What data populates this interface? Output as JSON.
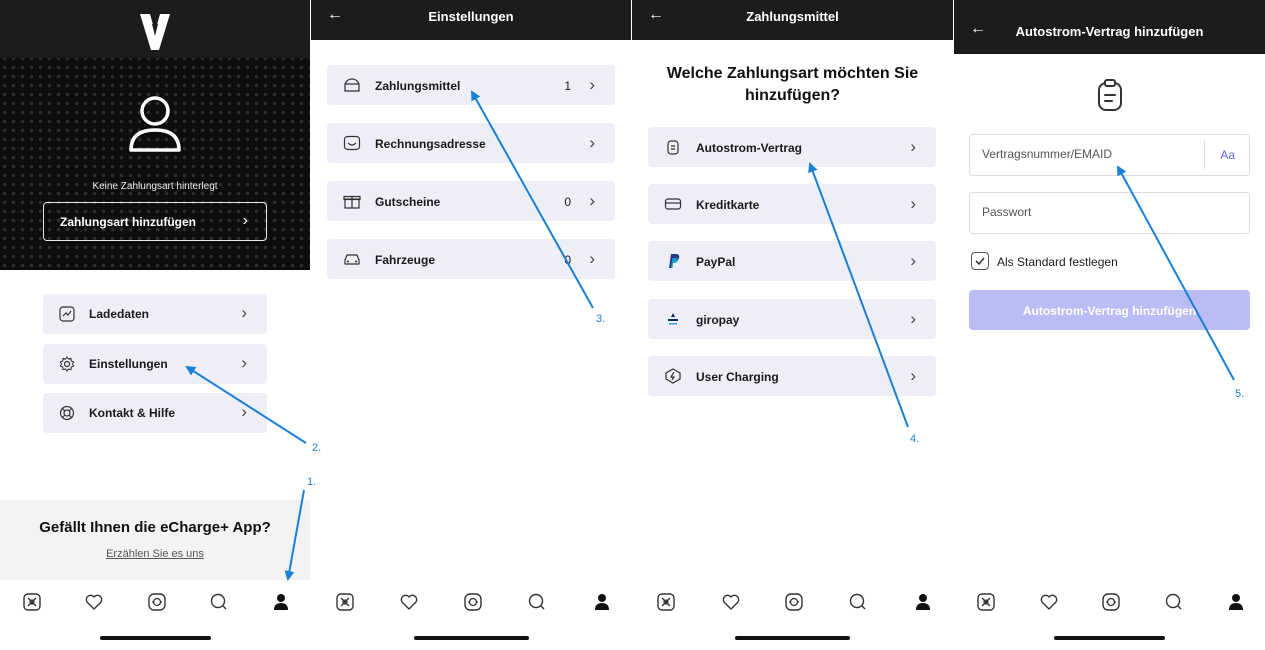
{
  "screen1": {
    "no_payment_text": "Keine Zahlungsart hinterlegt",
    "add_payment_label": "Zahlungsart hinzufügen",
    "menu": [
      {
        "label": "Ladedaten",
        "icon": "chart-icon"
      },
      {
        "label": "Einstellungen",
        "icon": "gear-icon"
      },
      {
        "label": "Kontakt & Hilfe",
        "icon": "lifebuoy-icon"
      }
    ],
    "rating_title": "Gefällt Ihnen die eCharge+ App?",
    "rating_link": "Erzählen Sie es uns"
  },
  "screen2": {
    "title": "Einstellungen",
    "rows": [
      {
        "label": "Zahlungsmittel",
        "count": "1",
        "icon": "wallet-icon"
      },
      {
        "label": "Rechnungsadresse",
        "count": "",
        "icon": "address-icon"
      },
      {
        "label": "Gutscheine",
        "count": "0",
        "icon": "gift-icon"
      },
      {
        "label": "Fahrzeuge",
        "count": "0",
        "icon": "car-icon"
      }
    ]
  },
  "screen3": {
    "title": "Zahlungsmittel",
    "question": "Welche Zahlungsart möchten Sie hinzufügen?",
    "rows": [
      {
        "label": "Autostrom-Vertrag",
        "icon": "contract-icon"
      },
      {
        "label": "Kreditkarte",
        "icon": "credit-card-icon"
      },
      {
        "label": "PayPal",
        "icon": "paypal-icon"
      },
      {
        "label": "giropay",
        "icon": "giropay-icon"
      },
      {
        "label": "User Charging",
        "icon": "lightning-icon"
      }
    ]
  },
  "screen4": {
    "title": "Autostrom-Vertrag hinzufügen",
    "contract_placeholder": "Vertragsnummer/EMAID",
    "aa_label": "Aa",
    "password_placeholder": "Passwort",
    "default_label": "Als Standard festlegen",
    "submit_label": "Autostrom-Vertrag hinzufügen"
  },
  "tabbar": {
    "icons": [
      "map-icon",
      "heart-icon",
      "charger-icon",
      "search-icon",
      "profile-icon"
    ]
  },
  "annotations": [
    "1.",
    "2.",
    "3.",
    "4.",
    "5."
  ],
  "colors": {
    "header_bg": "#1c1c1c",
    "row_bg": "#eeeef6",
    "accent": "#1a7fd6",
    "disabled_button": "#b9bdf3"
  }
}
